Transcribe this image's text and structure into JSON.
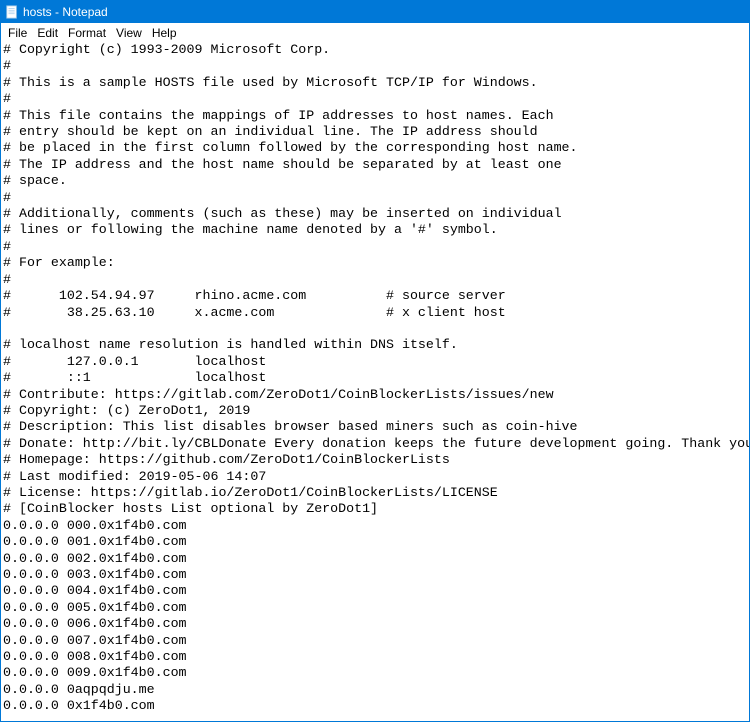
{
  "window": {
    "title": "hosts - Notepad"
  },
  "menu": {
    "file": "File",
    "edit": "Edit",
    "format": "Format",
    "view": "View",
    "help": "Help"
  },
  "content": "# Copyright (c) 1993-2009 Microsoft Corp.\n#\n# This is a sample HOSTS file used by Microsoft TCP/IP for Windows.\n#\n# This file contains the mappings of IP addresses to host names. Each\n# entry should be kept on an individual line. The IP address should\n# be placed in the first column followed by the corresponding host name.\n# The IP address and the host name should be separated by at least one\n# space.\n#\n# Additionally, comments (such as these) may be inserted on individual\n# lines or following the machine name denoted by a '#' symbol.\n#\n# For example:\n#\n#      102.54.94.97     rhino.acme.com          # source server\n#       38.25.63.10     x.acme.com              # x client host\n\n# localhost name resolution is handled within DNS itself.\n#       127.0.0.1       localhost\n#       ::1             localhost\n# Contribute: https://gitlab.com/ZeroDot1/CoinBlockerLists/issues/new\n# Copyright: (c) ZeroDot1, 2019\n# Description: This list disables browser based miners such as coin-hive\n# Donate: http://bit.ly/CBLDonate Every donation keeps the future development going. Thank you.\n# Homepage: https://github.com/ZeroDot1/CoinBlockerLists\n# Last modified: 2019-05-06 14:07\n# License: https://gitlab.io/ZeroDot1/CoinBlockerLists/LICENSE\n# [CoinBlocker hosts List optional by ZeroDot1]\n0.0.0.0 000.0x1f4b0.com\n0.0.0.0 001.0x1f4b0.com\n0.0.0.0 002.0x1f4b0.com\n0.0.0.0 003.0x1f4b0.com\n0.0.0.0 004.0x1f4b0.com\n0.0.0.0 005.0x1f4b0.com\n0.0.0.0 006.0x1f4b0.com\n0.0.0.0 007.0x1f4b0.com\n0.0.0.0 008.0x1f4b0.com\n0.0.0.0 009.0x1f4b0.com\n0.0.0.0 0aqpqdju.me\n0.0.0.0 0x1f4b0.com"
}
